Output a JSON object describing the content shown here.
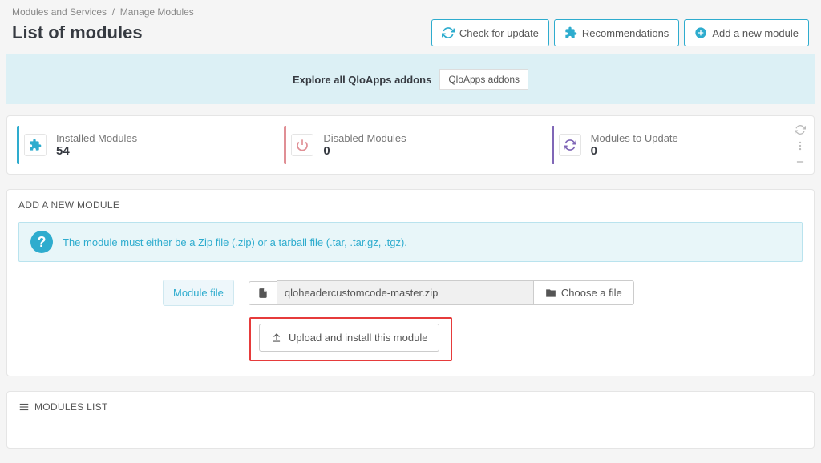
{
  "breadcrumb": {
    "parent": "Modules and Services",
    "current": "Manage Modules"
  },
  "page_title": "List of modules",
  "header_buttons": {
    "check_update": "Check for update",
    "recommendations": "Recommendations",
    "add_module": "Add a new module"
  },
  "explore": {
    "text": "Explore all QloApps addons",
    "button": "QloApps addons"
  },
  "stats": {
    "installed": {
      "label": "Installed Modules",
      "value": "54"
    },
    "disabled": {
      "label": "Disabled Modules",
      "value": "0"
    },
    "update": {
      "label": "Modules to Update",
      "value": "0"
    }
  },
  "add_panel": {
    "title": "ADD A NEW MODULE",
    "info": "The module must either be a Zip file (.zip) or a tarball file (.tar, .tar.gz, .tgz).",
    "field_label": "Module file",
    "file_name": "qloheadercustomcode-master.zip",
    "choose_label": "Choose a file",
    "upload_label": "Upload and install this module"
  },
  "list_panel": {
    "title": "MODULES LIST"
  },
  "colors": {
    "blue": "#2eacce",
    "red": "#e08f95",
    "purple": "#8067b7"
  }
}
